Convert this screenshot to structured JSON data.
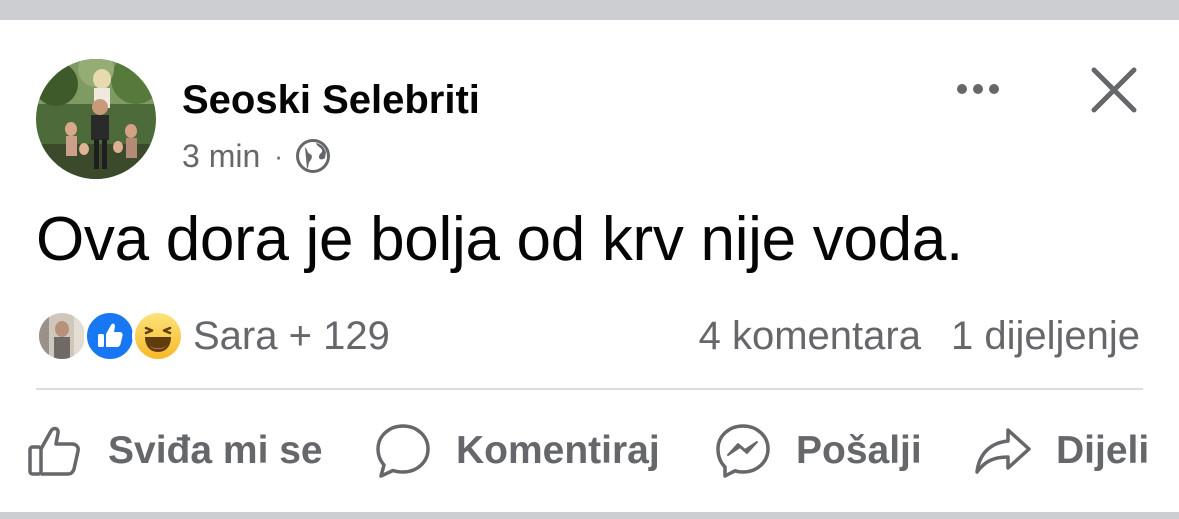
{
  "post": {
    "author": "Seoski Selebriti",
    "time": "3 min",
    "separator": "·",
    "privacy_icon": "globe-icon",
    "text": "Ova dora je bolja od krv nije voda."
  },
  "header_icons": [
    "more-options-icon",
    "close-icon"
  ],
  "reactions": {
    "icons": [
      "friend-photo",
      "like-reaction-icon",
      "haha-reaction-icon"
    ],
    "summary": "Sara + 129"
  },
  "counts": {
    "comments": "4 komentara",
    "shares": "1 dijeljenje"
  },
  "actions": {
    "like": "Sviđa mi se",
    "comment": "Komentiraj",
    "send": "Pošalji",
    "share": "Dijeli"
  },
  "colors": {
    "text_primary": "#050505",
    "text_secondary": "#65676b",
    "like_blue": "#1877f2",
    "haha_yellow": "#f7b928",
    "divider": "#dadde1",
    "feed_background": "#ccced2"
  }
}
